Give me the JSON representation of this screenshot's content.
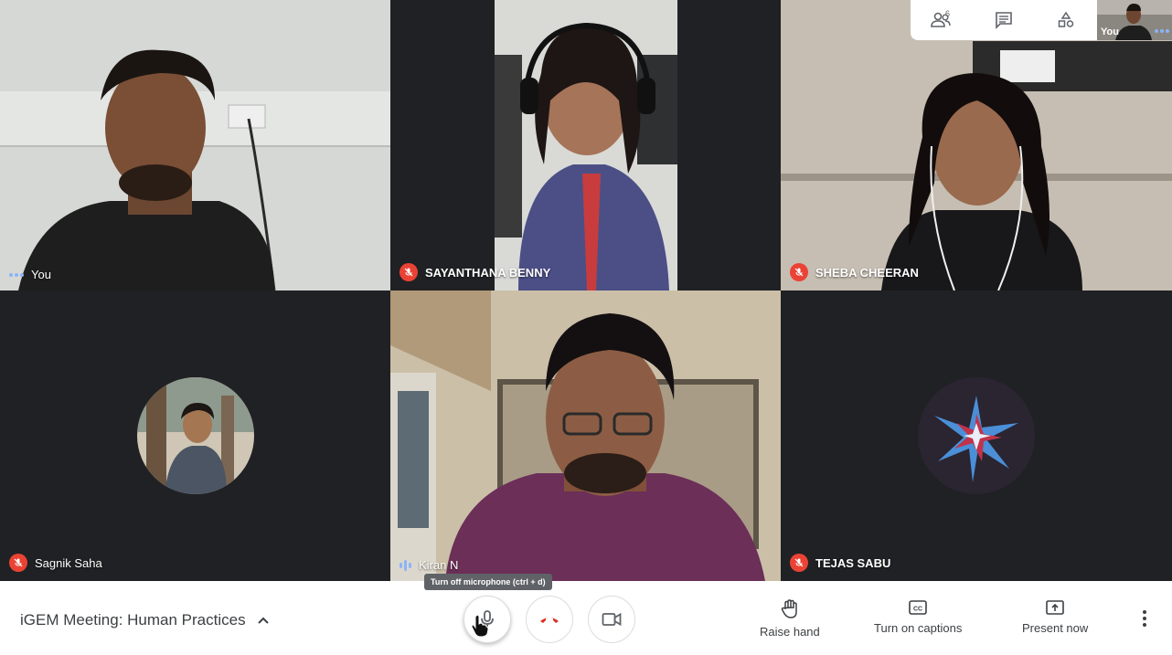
{
  "participants": [
    {
      "name": "You",
      "indicator": "active-dots"
    },
    {
      "name": "SAYANTHANA BENNY",
      "indicator": "muted"
    },
    {
      "name": "SHEBA CHEERAN",
      "indicator": "muted"
    },
    {
      "name": "Sagnik Saha",
      "indicator": "muted"
    },
    {
      "name": "Kiran N",
      "indicator": "speaking"
    },
    {
      "name": "TEJAS SABU",
      "indicator": "muted"
    }
  ],
  "topbar": {
    "participants_count": "6",
    "self_label": "You",
    "icons": [
      "people-icon",
      "chat-icon",
      "activities-icon"
    ]
  },
  "bottombar": {
    "meeting_title": "iGEM Meeting: Human Practices",
    "tooltip": "Turn off microphone (ctrl + d)",
    "raise_hand": "Raise hand",
    "captions": "Turn on captions",
    "present": "Present now"
  },
  "colors": {
    "mute_red": "#ea4335",
    "active_blue": "#8ab4f8",
    "tile_background": "#202124",
    "hangup_red": "#d93025"
  }
}
